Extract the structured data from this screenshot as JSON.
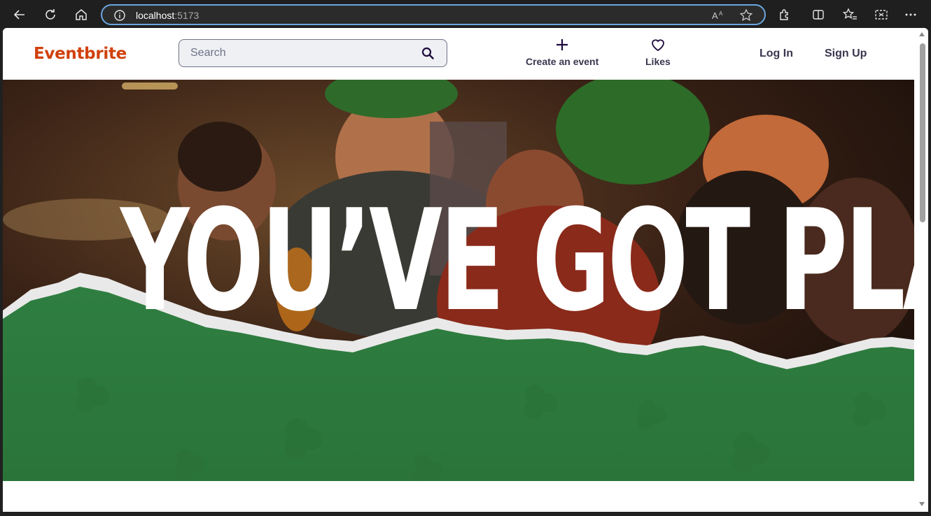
{
  "browser": {
    "url_host": "localhost",
    "url_port": ":5173"
  },
  "header": {
    "logo": "Eventbrite",
    "search_placeholder": "Search",
    "create_event_label": "Create an event",
    "likes_label": "Likes",
    "login_label": "Log In",
    "signup_label": "Sign Up",
    "brand_color": "#d1410c"
  },
  "hero": {
    "headline": "YOU’VE GOT PLANS",
    "green_color": "#2e7d3f"
  }
}
